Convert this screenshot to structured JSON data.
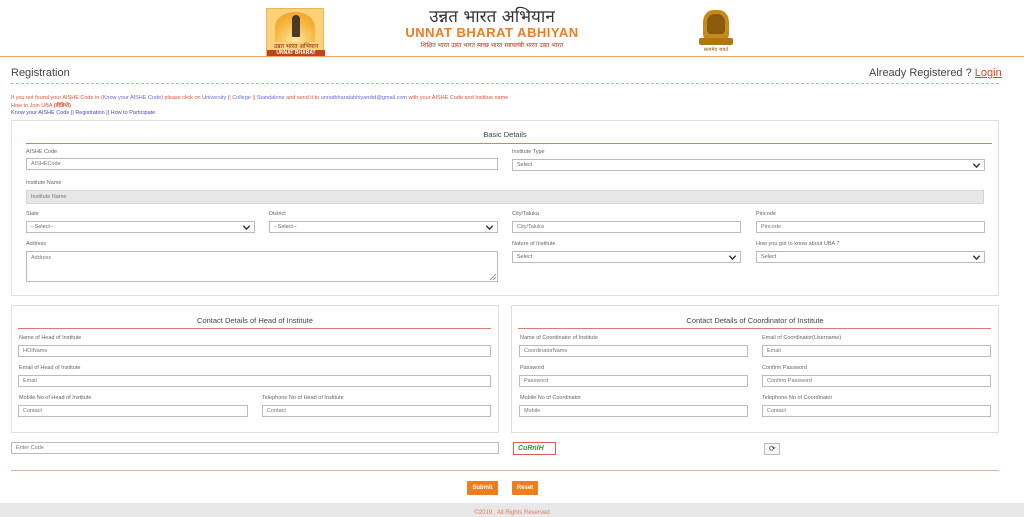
{
  "header": {
    "logo_hi": "उन्नत भारत अभियान",
    "logo_en": "UNNAT BHARAT ABHIYAN",
    "title_hi": "उन्नत भारत अभियान",
    "title_en": "UNNAT BHARAT ABHIYAN",
    "tagline": "शिक्षित भारत उन्नत भारत स्वच्छ भारत स्वावलंबी भारत उन्नत भारत",
    "emblem_text": "सत्यमेव जयते"
  },
  "page": {
    "title": "Registration",
    "already_registered": "Already Registered ?",
    "login_link": "Login"
  },
  "notice": {
    "line1_a": "If you not found your AISHE Code in (",
    "line1_link1": "Know your AISHE Code",
    "line1_b": ") please click on ",
    "line1_link2": "University",
    "line1_sep1": " || ",
    "line1_link3": "College",
    "line1_sep2": " || ",
    "line1_link4": "Standalone",
    "line1_c": " and send it to ",
    "line1_email": "unnatbharatabhiyaniitd@gmail.com",
    "line1_d": " with your AISHE Code and Institue name",
    "line2_a": "How to Join UBA ",
    "line2_b": "(वीडियो)",
    "line3_link1": "Know your AISHE Code",
    "line3_sep1": " || ",
    "line3_link2": "Registration",
    "line3_sep2": " || ",
    "line3_link3": "How to Participate"
  },
  "basic": {
    "title": "Basic Details",
    "aishe_label": "AISHE Code",
    "aishe_placeholder": "AISHECode",
    "type_label": "Institute Type",
    "type_value": "Select",
    "name_label": "Institute Name",
    "name_placeholder": "Institute Name",
    "state_label": "State",
    "state_value": "--Select--",
    "district_label": "District",
    "district_value": "--Select--",
    "city_label": "City/Taluka",
    "city_placeholder": "City/Taluka",
    "pincode_label": "Pincode",
    "pincode_placeholder": "Pincode",
    "address_label": "Address",
    "address_placeholder": "Address",
    "nature_label": "Nature of Institute",
    "nature_value": "Select",
    "know_label": "How you got to know about UBA ?",
    "know_value": "Select"
  },
  "head": {
    "title": "Contact Details of Head of Institute",
    "name_label": "Name of Head of Institute",
    "name_placeholder": "HOIName",
    "email_label": "Email of Head of Institute",
    "email_placeholder": "Email",
    "mobile_label": "Mobile No of Head of Institute",
    "mobile_placeholder": "Contact",
    "phone_label": "Telephone No of Head of Institute",
    "phone_placeholder": "Contact"
  },
  "coord": {
    "title": "Contact Details of Coordinator of Institute",
    "name_label": "Name of Coordinator of Institute",
    "name_placeholder": "CoordinatorName",
    "email_label": "Email of Coordinator(Username)",
    "email_placeholder": "Email",
    "password_label": "Password",
    "password_placeholder": "Password",
    "confirm_label": "Confirm Password",
    "confirm_placeholder": "Confirm Password",
    "mobile_label": "Mobile No of Coordinator",
    "mobile_placeholder": "Mobile",
    "phone_label": "Telephone No of Coordinator",
    "phone_placeholder": "Contact"
  },
  "captcha": {
    "input_placeholder": "Enter Code",
    "code": "CuRnlH",
    "refresh_icon": "refresh-icon"
  },
  "buttons": {
    "submit": "Submit",
    "reset": "Reset"
  },
  "footer": {
    "text": "©2019 , All Rights Reserved"
  },
  "colors": {
    "accent": "#f07c1e",
    "link": "#e8412a",
    "rule": "#e07a6a"
  }
}
